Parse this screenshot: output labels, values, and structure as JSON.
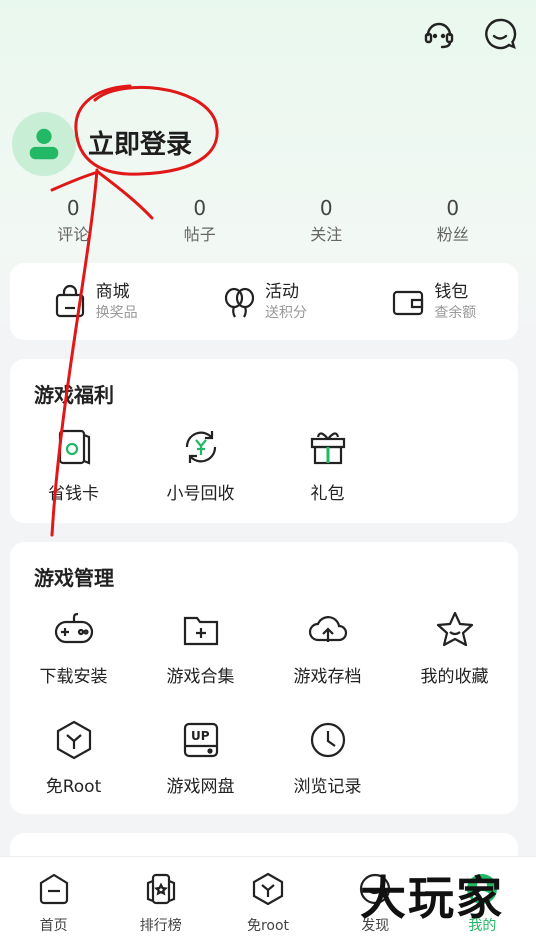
{
  "header": {
    "icons": [
      "customer-service-icon",
      "message-icon"
    ]
  },
  "profile": {
    "login_label": "立即登录"
  },
  "stats": [
    {
      "value": "0",
      "label": "评论"
    },
    {
      "value": "0",
      "label": "帖子"
    },
    {
      "value": "0",
      "label": "关注"
    },
    {
      "value": "0",
      "label": "粉丝"
    }
  ],
  "quick": [
    {
      "title": "商城",
      "sub": "换奖品",
      "icon": "shopping-bag-icon"
    },
    {
      "title": "活动",
      "sub": "送积分",
      "icon": "balloon-icon"
    },
    {
      "title": "钱包",
      "sub": "查余额",
      "icon": "wallet-icon"
    }
  ],
  "benefits": {
    "title": "游戏福利",
    "items": [
      {
        "label": "省钱卡",
        "icon": "saving-card-icon"
      },
      {
        "label": "小号回收",
        "icon": "recycle-icon"
      },
      {
        "label": "礼包",
        "icon": "gift-icon"
      }
    ]
  },
  "management": {
    "title": "游戏管理",
    "items": [
      {
        "label": "下载安装",
        "icon": "gamepad-icon"
      },
      {
        "label": "游戏合集",
        "icon": "folder-plus-icon"
      },
      {
        "label": "游戏存档",
        "icon": "cloud-upload-icon"
      },
      {
        "label": "我的收藏",
        "icon": "star-icon"
      },
      {
        "label": "免Root",
        "icon": "hexagon-y-icon"
      },
      {
        "label": "游戏网盘",
        "icon": "up-disk-icon"
      },
      {
        "label": "浏览记录",
        "icon": "clock-icon"
      }
    ]
  },
  "nav": [
    {
      "label": "首页",
      "icon": "home-icon"
    },
    {
      "label": "排行榜",
      "icon": "ranking-icon"
    },
    {
      "label": "免root",
      "icon": "hexagon-y-icon"
    },
    {
      "label": "发现",
      "icon": "discover-icon"
    },
    {
      "label": "我的",
      "icon": "profile-icon",
      "active": true
    }
  ],
  "watermark": "大玩家",
  "colors": {
    "accent": "#22b865",
    "annotation": "#e01818"
  }
}
